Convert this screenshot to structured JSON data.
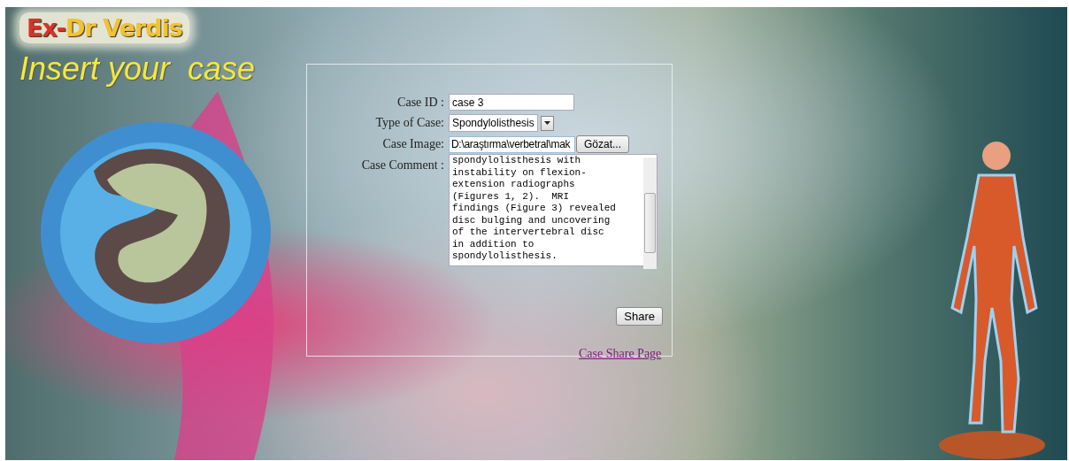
{
  "logo": {
    "parts": [
      {
        "text": "Ex-",
        "color": "#d8322a"
      },
      {
        "text": "Dr Verdis",
        "color": "#f2c232"
      }
    ]
  },
  "heading": "Insert your  case",
  "form": {
    "case_id": {
      "label": "Case ID :",
      "value": "case 3"
    },
    "type_of_case": {
      "label": "Type of Case:",
      "value": "Spondylolisthesis"
    },
    "case_image": {
      "label": "Case Image:",
      "value": "D:\\araştırma\\verbetral\\mak",
      "button": "Gözat..."
    },
    "case_comment": {
      "label": "Case Comment :",
      "lines": [
        "spondylolisthesis with",
        "instability on flexion-",
        "extension radiographs",
        "(Figures 1, 2).  MRI",
        "findings (Figure 3) revealed",
        "disc bulging and uncovering",
        "of the intervertebral disc",
        "in addition to",
        "spondylolisthesis."
      ]
    },
    "share_button": "Share",
    "link": "Case Share Page"
  }
}
